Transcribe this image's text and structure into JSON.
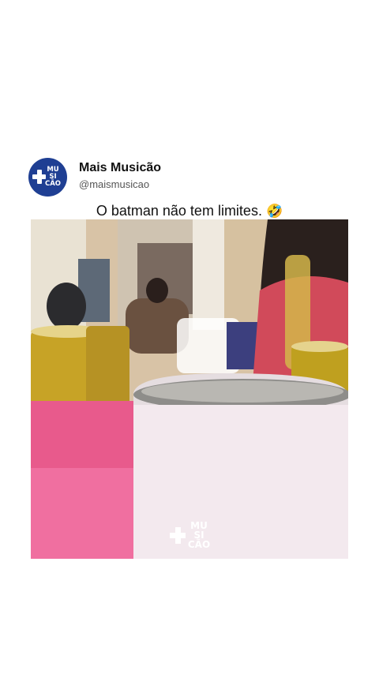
{
  "post": {
    "display_name": "Mais Musicão",
    "handle": "@maismusicao",
    "caption": "O batman não tem limites.",
    "caption_emoji": "🤣",
    "avatar_logo_lines": [
      "MU",
      "SI",
      "CÃO"
    ]
  },
  "video": {
    "watermark_lines": [
      "MU",
      "SI",
      "CÃO"
    ],
    "watermark_icon": "plus-icon"
  },
  "colors": {
    "brand_blue": "#1f3f93",
    "background": "#ffffff"
  }
}
